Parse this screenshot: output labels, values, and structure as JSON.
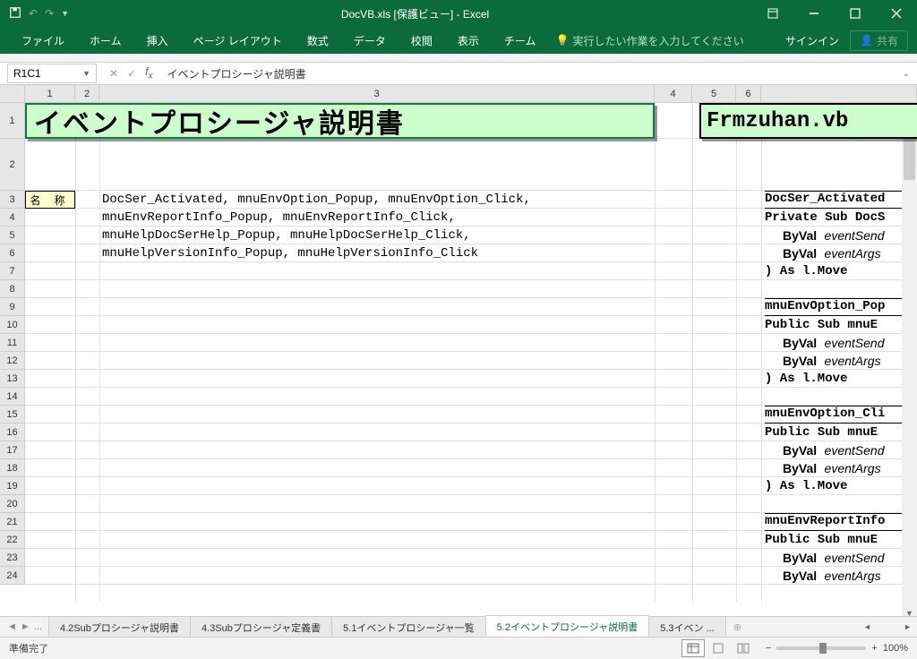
{
  "titlebar": {
    "title": "DocVB.xls [保護ビュー] - Excel"
  },
  "ribbon": {
    "tabs": [
      "ファイル",
      "ホーム",
      "挿入",
      "ページ レイアウト",
      "数式",
      "データ",
      "校閲",
      "表示",
      "チーム"
    ],
    "tell_me": "実行したい作業を入力してください",
    "signin": "サインイン",
    "share": "共有"
  },
  "formula": {
    "namebox": "R1C1",
    "content": "イベントプロシージャ説明書"
  },
  "columns": [
    "1",
    "2",
    "3",
    "4",
    "5",
    "6"
  ],
  "rows": [
    "1",
    "2",
    "3",
    "4",
    "5",
    "6",
    "7",
    "8",
    "9",
    "10",
    "11",
    "12",
    "13",
    "14",
    "15",
    "16",
    "17",
    "18",
    "19",
    "20",
    "21",
    "22",
    "23",
    "24"
  ],
  "sheet": {
    "title_left": "イベントプロシージャ説明書",
    "title_right": "Frmzuhan.vb",
    "label": "名 称",
    "lines": [
      "DocSer_Activated, mnuEnvOption_Popup, mnuEnvOption_Click,",
      "mnuEnvReportInfo_Popup, mnuEnvReportInfo_Click,",
      "mnuHelpDocSerHelp_Popup, mnuHelpDocSerHelp_Click,",
      "mnuHelpVersionInfo_Popup, mnuHelpVersionInfo_Click"
    ],
    "right_panel": {
      "blocks": [
        {
          "h": "DocSer_Activated",
          "s": "Private Sub DocS",
          "b1": "ByVal eventSend",
          "b2": "ByVal eventArgs",
          "f": ") As l.Move"
        },
        {
          "h": "mnuEnvOption_Pop",
          "s": "Public Sub mnuE",
          "b1": "ByVal eventSend",
          "b2": "ByVal eventArgs",
          "f": ") As l.Move"
        },
        {
          "h": "mnuEnvOption_Cli",
          "s": "Public Sub mnuE",
          "b1": "ByVal eventSend",
          "b2": "ByVal eventArgs",
          "f": ") As l.Move"
        },
        {
          "h": "mnuEnvReportInfo",
          "s": "Public Sub mnuE",
          "b1": "ByVal eventSend",
          "b2": "ByVal eventArgs",
          "f": ""
        }
      ]
    }
  },
  "tabs": {
    "items": [
      "4.2Subプロシージャ説明書",
      "4.3Subプロシージャ定義書",
      "5.1イベントプロシージャ一覧",
      "5.2イベントプロシージャ説明書",
      "5.3イベン"
    ],
    "active_index": 3,
    "ellipsis": "...",
    "more": "..."
  },
  "status": {
    "ready": "準備完了",
    "zoom": "100%"
  }
}
